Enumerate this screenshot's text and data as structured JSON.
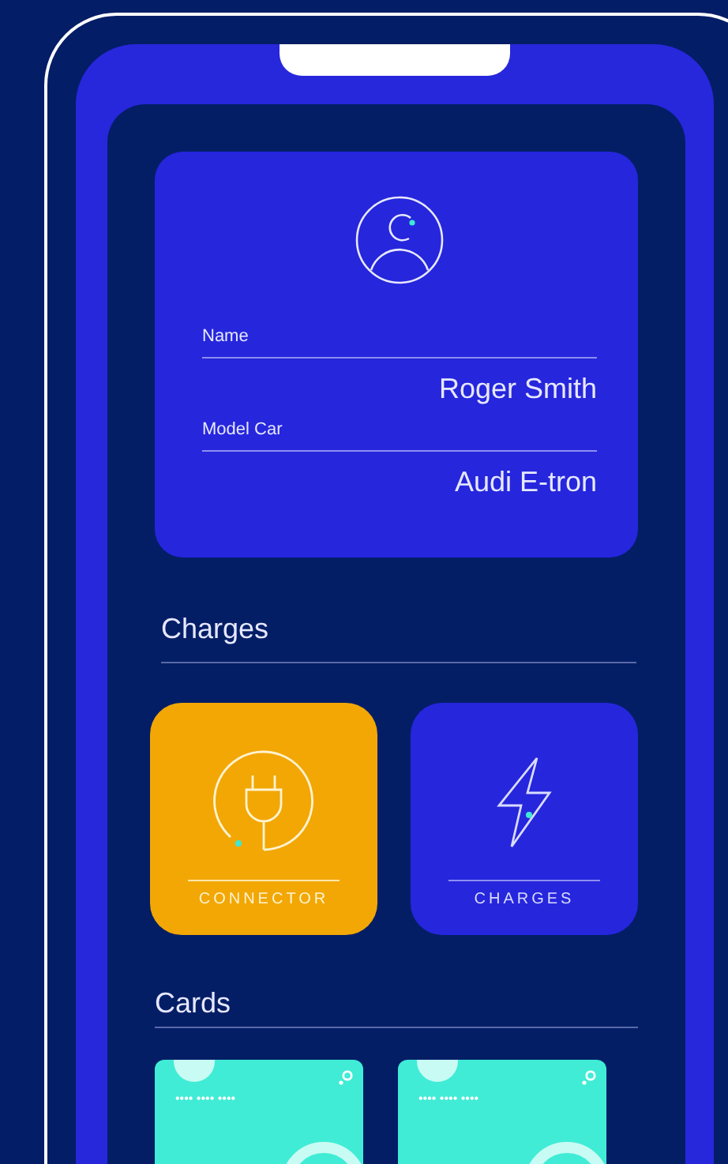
{
  "profile": {
    "fields": [
      {
        "label": "Name",
        "value": "Roger Smith"
      },
      {
        "label": "Model Car",
        "value": "Audi E-tron"
      }
    ]
  },
  "charges": {
    "title": "Charges",
    "tiles": [
      {
        "kind": "connector",
        "label": "CONNECTOR",
        "selected": true
      },
      {
        "kind": "charges",
        "label": "CHARGES",
        "selected": false
      }
    ]
  },
  "cards": {
    "title": "Cards",
    "items": [
      {
        "number": "•••• •••• ••••"
      },
      {
        "number": "•••• •••• ••••"
      }
    ]
  }
}
